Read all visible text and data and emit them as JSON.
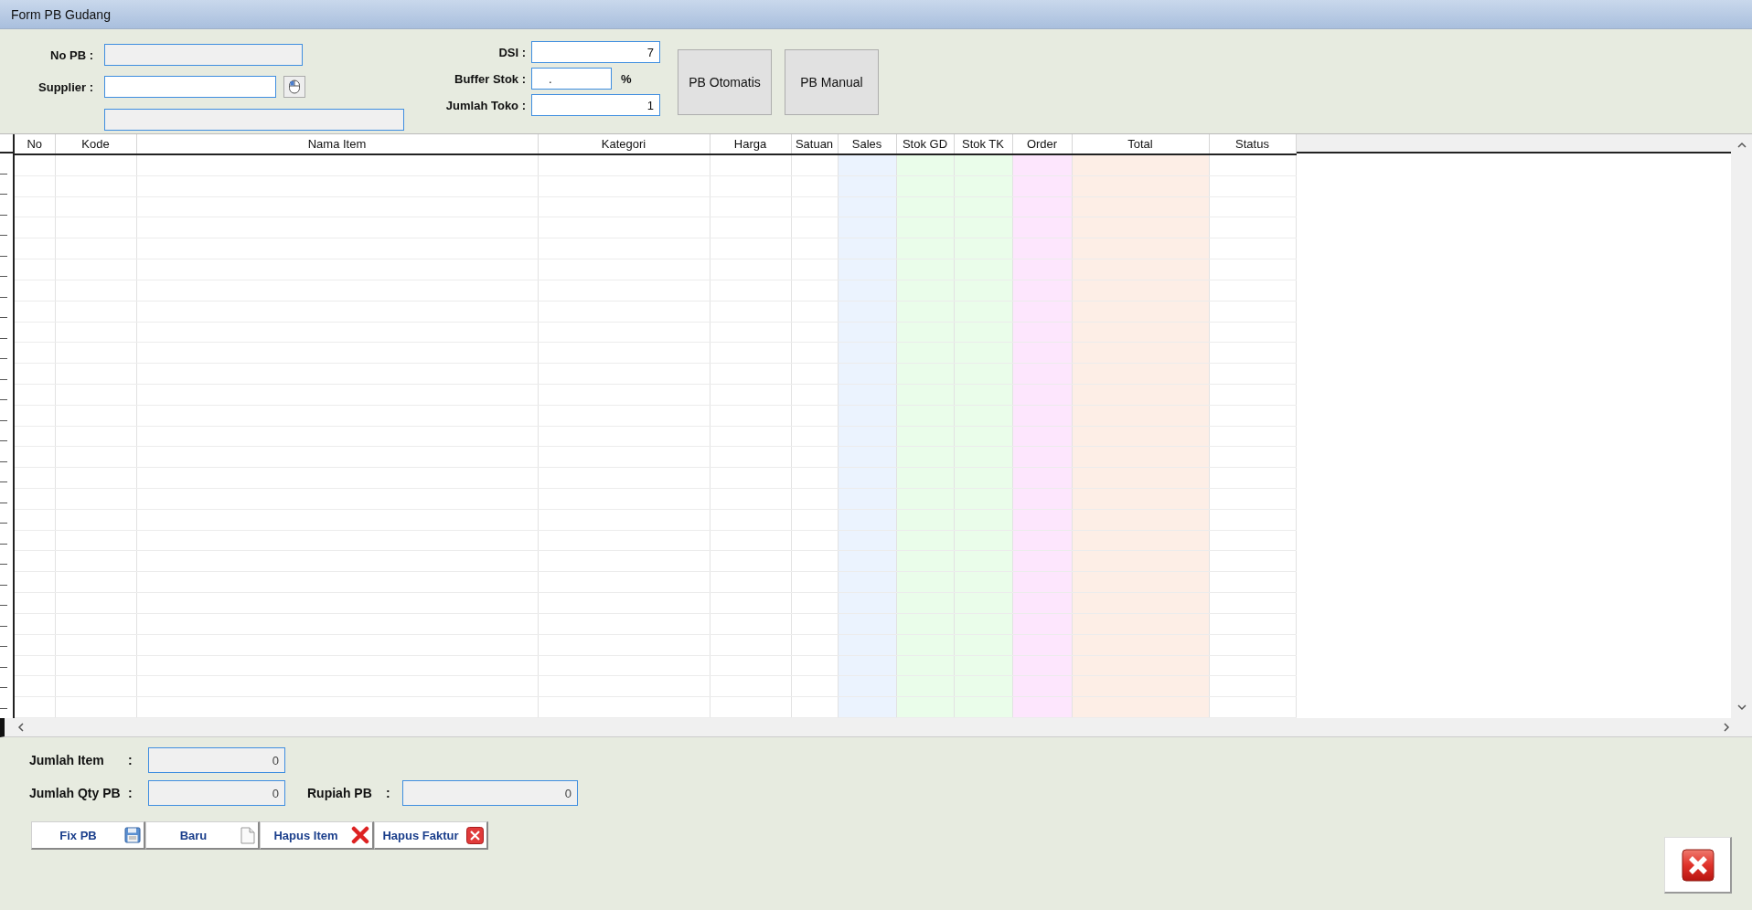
{
  "window": {
    "title": "Form PB Gudang"
  },
  "header_form": {
    "no_pb": {
      "label": "No PB :",
      "disabled": true
    },
    "supplier": {
      "label": "Supplier :",
      "disabled": false
    },
    "supplier_name": {
      "disabled": true
    },
    "dsi": {
      "label": "DSI :",
      "value": "7"
    },
    "buffer_stok": {
      "label": "Buffer Stok :",
      "value": ".",
      "unit": "%"
    },
    "jumlah_toko": {
      "label": "Jumlah Toko :",
      "value": "1"
    },
    "buttons": [
      "PB Otomatis",
      "PB Manual"
    ]
  },
  "table": {
    "columns": [
      {
        "label": "No"
      },
      {
        "label": "Kode"
      },
      {
        "label": "Nama Item"
      },
      {
        "label": "Kategori"
      },
      {
        "label": "Harga"
      },
      {
        "label": "Satuan"
      },
      {
        "label": "Sales",
        "color": "#ebf3fe"
      },
      {
        "label": "Stok GD",
        "color": "#eafdea"
      },
      {
        "label": "Stok TK",
        "color": "#eafdea"
      },
      {
        "label": "Order",
        "color": "#fde6fd"
      },
      {
        "label": "Total",
        "color": "#fdeee6"
      },
      {
        "label": "Status"
      }
    ]
  },
  "summary": {
    "jumlah_item": {
      "label": "Jumlah Item",
      "colon": ":",
      "value": "0"
    },
    "jumlah_qty_pb": {
      "label": "Jumlah Qty PB",
      "colon": ":",
      "value": "0"
    },
    "rupiah_pb": {
      "label": "Rupiah PB",
      "colon": ":",
      "value": "0"
    }
  },
  "actions": [
    {
      "label": "Fix PB",
      "kind": "save"
    },
    {
      "label": "Baru",
      "kind": "new"
    },
    {
      "label": "Hapus Item",
      "kind": "delete"
    },
    {
      "label": "Hapus Faktur",
      "kind": "delete-box"
    }
  ],
  "close_button": {
    "kind": "close"
  }
}
